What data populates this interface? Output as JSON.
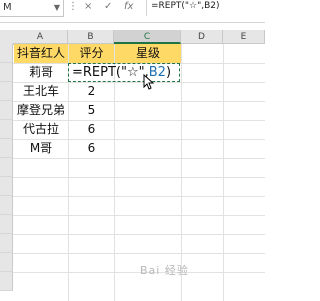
{
  "formula_bar": {
    "name_box": "M",
    "cancel_symbol": "×",
    "confirm_symbol": "✓",
    "fx_symbol": "fx",
    "formula_text": "=REPT(\"☆\",B2)"
  },
  "columns": [
    "A",
    "B",
    "C",
    "D",
    "E"
  ],
  "active_column": "C",
  "rows": [
    {
      "a": "抖音红人",
      "b": "评分",
      "c": "星级"
    },
    {
      "a": "莉哥",
      "b": "",
      "c": ""
    },
    {
      "a": "王北车",
      "b": "2",
      "c": ""
    },
    {
      "a": "摩登兄弟",
      "b": "5",
      "c": ""
    },
    {
      "a": "代古拉",
      "b": "6",
      "c": ""
    },
    {
      "a": "M哥",
      "b": "6",
      "c": ""
    }
  ],
  "editing_cell": {
    "formula_prefix": "=REPT(\"☆\",",
    "formula_ref": "B2",
    "formula_suffix": ")"
  },
  "header_fill_color": "#ffd966",
  "accent_color": "#217346",
  "watermark": "Bai 经验"
}
